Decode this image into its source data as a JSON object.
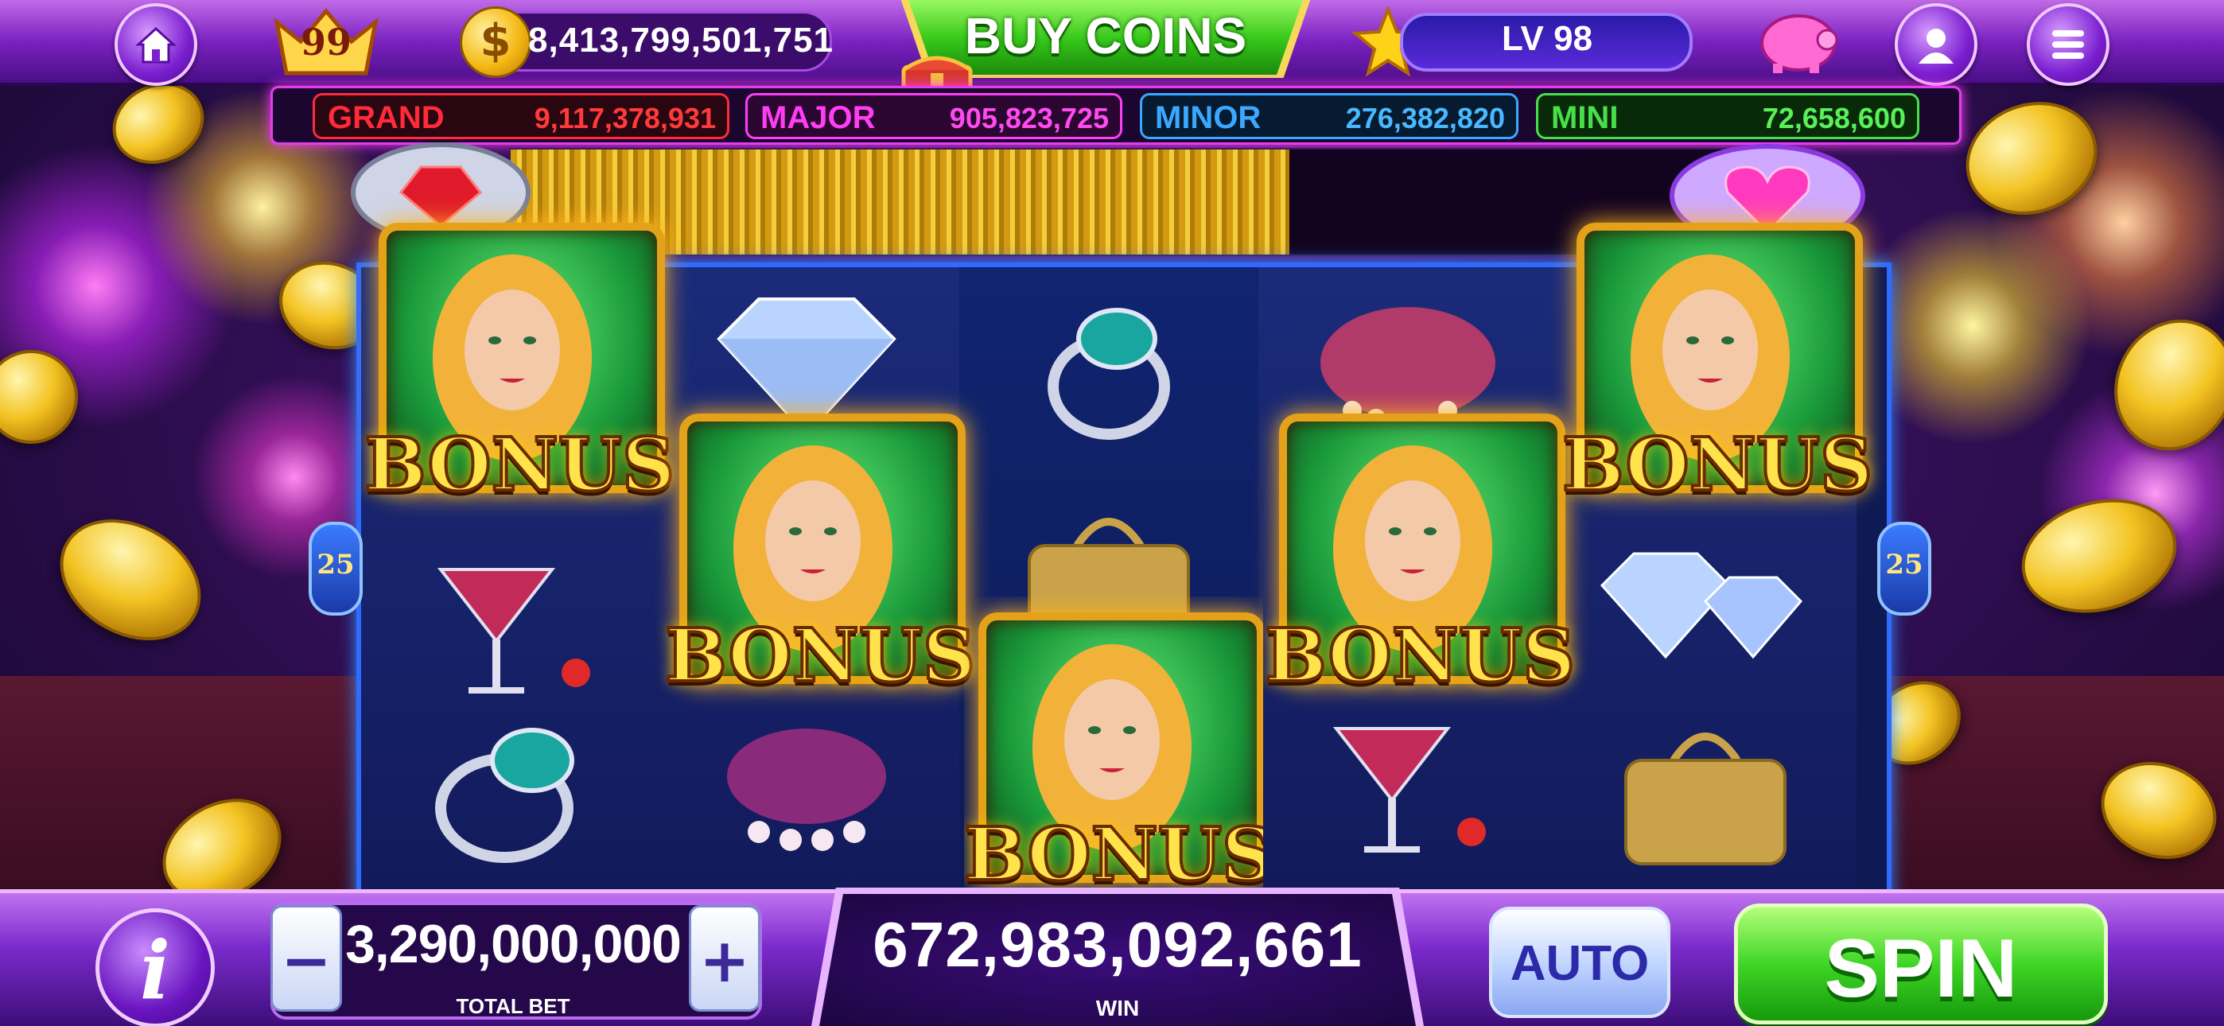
{
  "top_bar": {
    "vip_level": "99",
    "coin_balance": "8,413,799,501,751",
    "buy_coins_label": "BUY COINS",
    "player_level": "LV 98"
  },
  "jackpots": [
    {
      "name": "GRAND",
      "value": "9,117,378,931",
      "color": "#ff2a3a"
    },
    {
      "name": "MAJOR",
      "value": "905,823,725",
      "color": "#ff3df5"
    },
    {
      "name": "MINOR",
      "value": "276,382,820",
      "color": "#3aa8ff"
    },
    {
      "name": "MINI",
      "value": "72,658,600",
      "color": "#48e04a"
    }
  ],
  "reels": {
    "paylines_left": "25",
    "paylines_right": "25",
    "bonus_label": "BONUS",
    "symbols": [
      "bonus",
      "diamond",
      "ring",
      "purse",
      "bonus",
      "cocktail",
      "handbag",
      "diamonds",
      "ring",
      "pearls",
      "cocktail",
      "handbag"
    ]
  },
  "bottom_bar": {
    "total_bet": "3,290,000,000",
    "total_bet_label": "TOTAL BET",
    "win_amount": "672,983,092,661",
    "win_label": "WIN",
    "auto_label": "AUTO",
    "spin_label": "SPIN",
    "minus_label": "−",
    "plus_label": "+",
    "info_label": "i"
  },
  "colors": {
    "accent_purple": "#7a22c0",
    "spin_green": "#3fd626",
    "gold": "#f4cd3c"
  }
}
